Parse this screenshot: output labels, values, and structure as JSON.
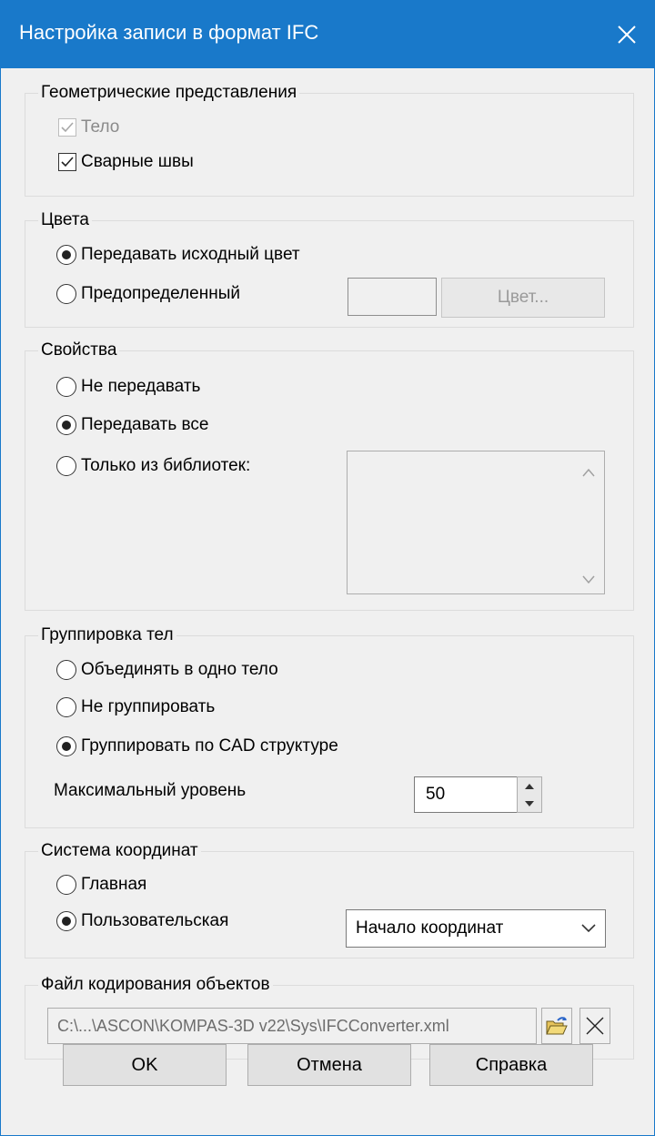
{
  "window": {
    "title": "Настройка записи в формат IFC"
  },
  "geometry": {
    "title": "Геометрические представления",
    "body_label": "Тело",
    "body_checked": true,
    "body_disabled": true,
    "welds_label": "Сварные швы",
    "welds_checked": true
  },
  "colors": {
    "title": "Цвета",
    "option_source": "Передавать исходный цвет",
    "option_predefined": "Предопределенный",
    "selected": "source",
    "color_button": "Цвет..."
  },
  "properties": {
    "title": "Свойства",
    "option_none": "Не передавать",
    "option_all": "Передавать все",
    "option_libs": "Только из библиотек:",
    "selected": "all"
  },
  "grouping": {
    "title": "Группировка тел",
    "option_merge": "Объединять в одно тело",
    "option_nogroup": "Не группировать",
    "option_cad": "Группировать по CAD структуре",
    "selected": "cad",
    "max_level_label": "Максимальный уровень",
    "max_level_value": "50"
  },
  "coords": {
    "title": "Система координат",
    "option_main": "Главная",
    "option_user": "Пользовательская",
    "selected": "user",
    "combo_value": "Начало координат"
  },
  "encoding": {
    "title": "Файл кодирования объектов",
    "path": "C:\\...\\ASCON\\KOMPAS-3D v22\\Sys\\IFCConverter.xml"
  },
  "buttons": {
    "ok": "OK",
    "cancel": "Отмена",
    "help": "Справка"
  },
  "style": {
    "titlebar_color": "#1979ca",
    "dialog_bg": "#f0f0f0"
  }
}
